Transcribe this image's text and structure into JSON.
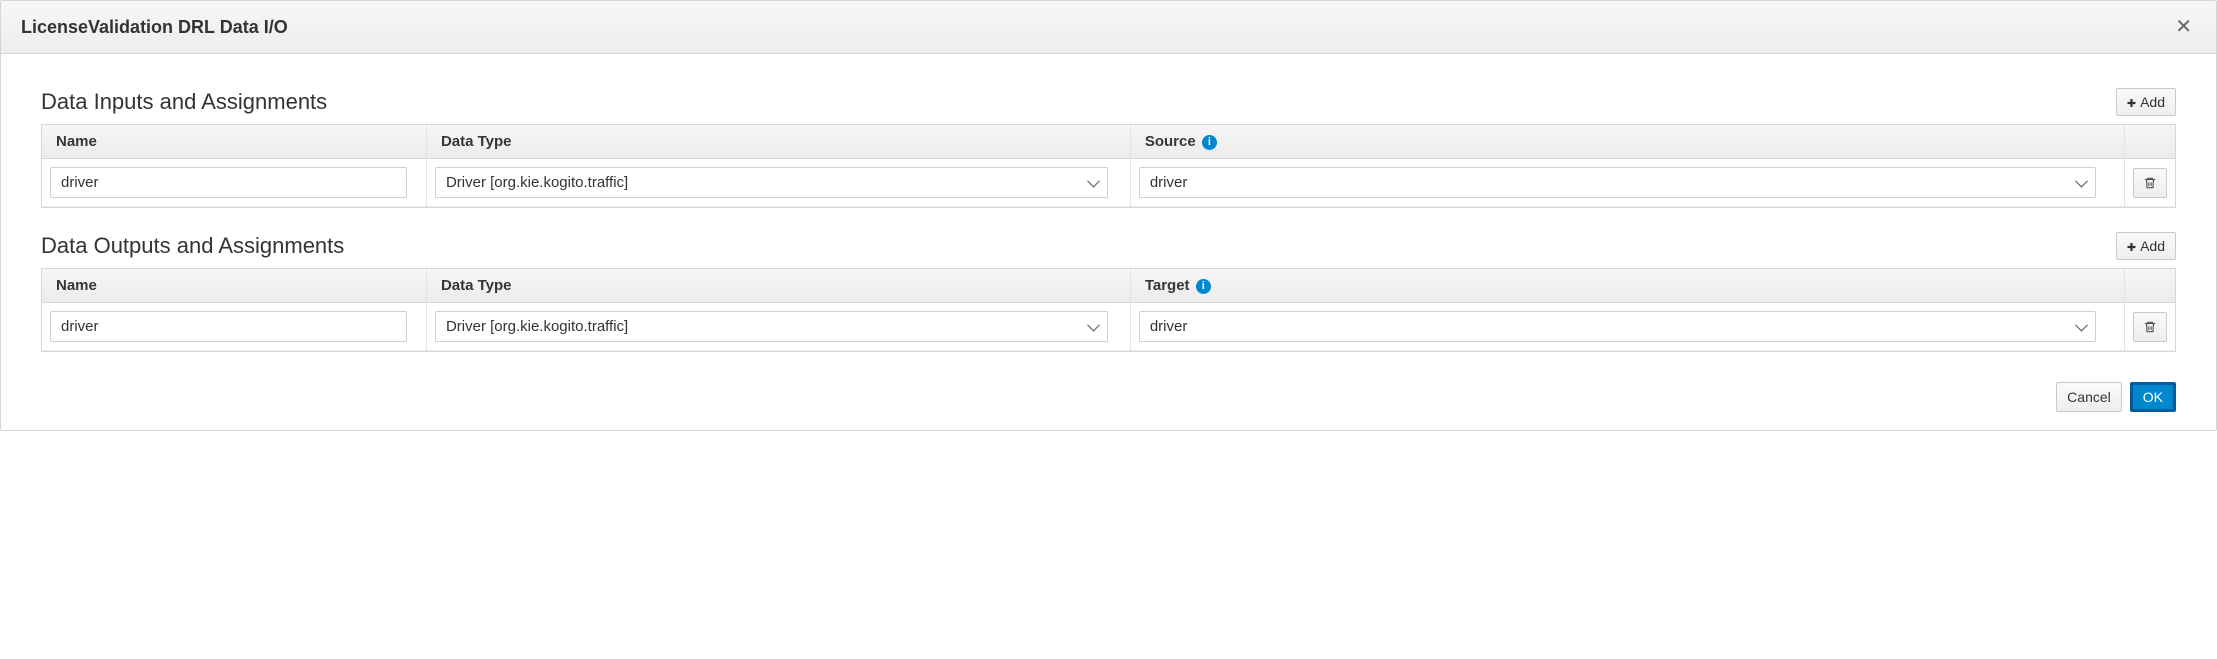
{
  "dialog": {
    "title": "LicenseValidation DRL Data I/O"
  },
  "buttons": {
    "add": "Add",
    "cancel": "Cancel",
    "ok": "OK"
  },
  "inputs_section": {
    "title": "Data Inputs and Assignments",
    "columns": {
      "name": "Name",
      "type": "Data Type",
      "source": "Source"
    },
    "rows": [
      {
        "name": "driver",
        "type_display": "Driver [org.kie.kogito.traffic]",
        "source_display": "driver"
      }
    ]
  },
  "outputs_section": {
    "title": "Data Outputs and Assignments",
    "columns": {
      "name": "Name",
      "type": "Data Type",
      "target": "Target"
    },
    "rows": [
      {
        "name": "driver",
        "type_display": "Driver [org.kie.kogito.traffic]",
        "target_display": "driver"
      }
    ]
  }
}
